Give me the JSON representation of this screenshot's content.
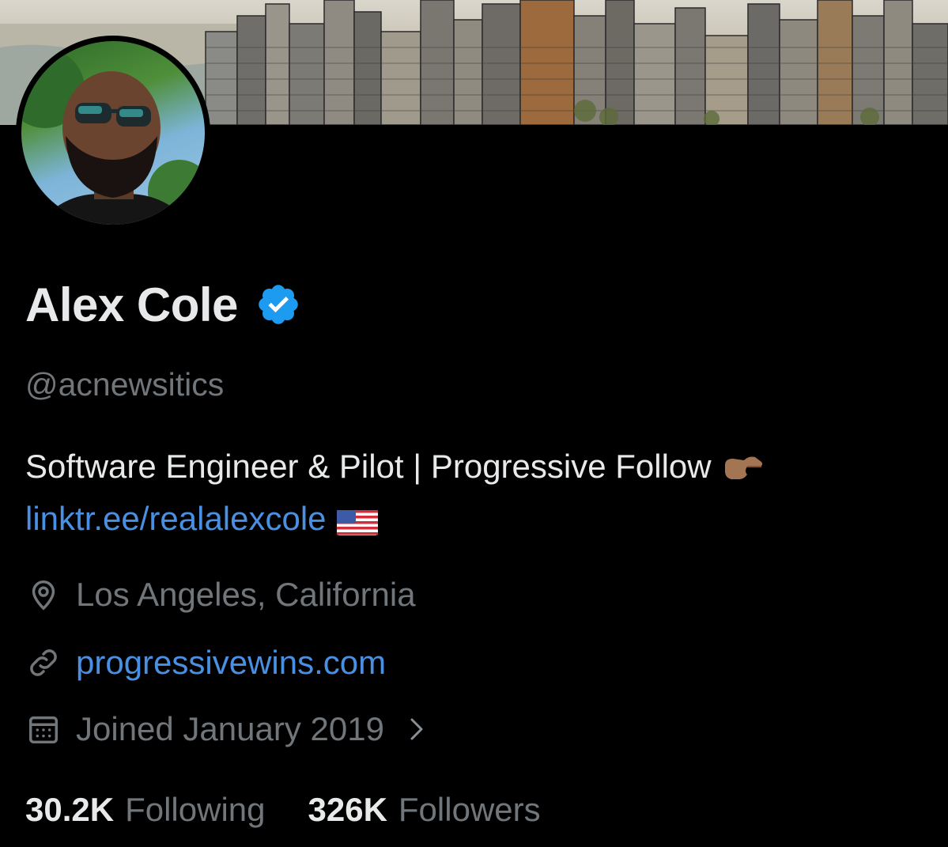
{
  "profile": {
    "name": "Alex Cole",
    "handle": "@acnewsitics",
    "bio_text": "Software Engineer & Pilot | Progressive Follow",
    "bio_link": "linktr.ee/realalexcole",
    "location": "Los Angeles, California",
    "website": "progressivewins.com",
    "joined": "Joined January 2019",
    "following_count": "30.2K",
    "following_label": "Following",
    "followers_count": "326K",
    "followers_label": "Followers"
  },
  "icons": {
    "verified": "verified-badge-icon",
    "location": "location-pin-icon",
    "website": "link-icon",
    "joined": "calendar-icon",
    "pointing": "pointing-right-emoji",
    "flag": "us-flag-emoji",
    "chevron": "chevron-right-icon"
  },
  "colors": {
    "background": "#000000",
    "text_primary": "#e7e9ea",
    "text_secondary": "#71767b",
    "link": "#4a90e2",
    "verified": "#1d9bf0"
  }
}
